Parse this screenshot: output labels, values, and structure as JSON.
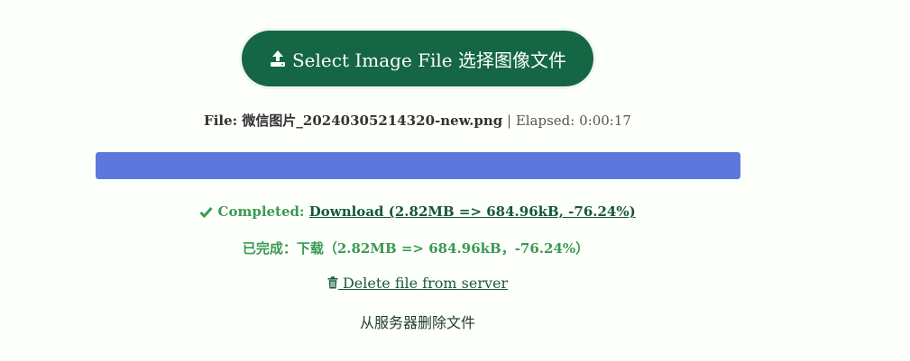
{
  "upload": {
    "label": "Select Image File 选择图像文件",
    "icon": "upload-icon"
  },
  "file_info": {
    "prefix": "File: ",
    "filename": "微信图片_20240305214320-new.png",
    "separator": " | ",
    "elapsed_label": "Elapsed: ",
    "elapsed_value": "0:00:17"
  },
  "progress": {
    "percent": 100,
    "color": "#5c78de"
  },
  "result": {
    "check_icon": "check-icon",
    "completed_label": "Completed: ",
    "download_link": "Download (2.82MB => 684.96kB, -76.24%)",
    "completed_cn": "已完成：下载（2.82MB => 684.96kB，-76.24%）"
  },
  "delete": {
    "icon": "trash-icon",
    "link_label": " Delete file from server",
    "label_cn": "从服务器删除文件"
  },
  "colors": {
    "button": "#146644",
    "success": "#3a9a52",
    "link": "#15573b"
  }
}
